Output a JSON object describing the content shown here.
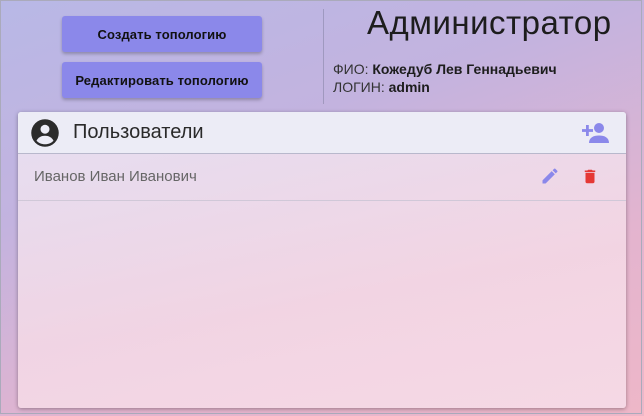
{
  "toolbar": {
    "create_label": "Создать топологию",
    "edit_label": "Редактировать топологию"
  },
  "profile": {
    "role_title": "Администратор",
    "fio_label": "ФИО: ",
    "fio_value": "Кожедуб Лев Геннадьевич",
    "login_label": "ЛОГИН: ",
    "login_value": "admin"
  },
  "users": {
    "title": "Пользователи",
    "header_icon": "account-circle-icon",
    "add_icon": "add-user-icon",
    "items": [
      {
        "name": "Иванов Иван Иванович",
        "edit_icon": "pencil-icon",
        "delete_icon": "trash-icon"
      }
    ]
  },
  "colors": {
    "button": "#8b88ea",
    "icon_accent": "#8b88ea",
    "delete": "#e53935"
  }
}
